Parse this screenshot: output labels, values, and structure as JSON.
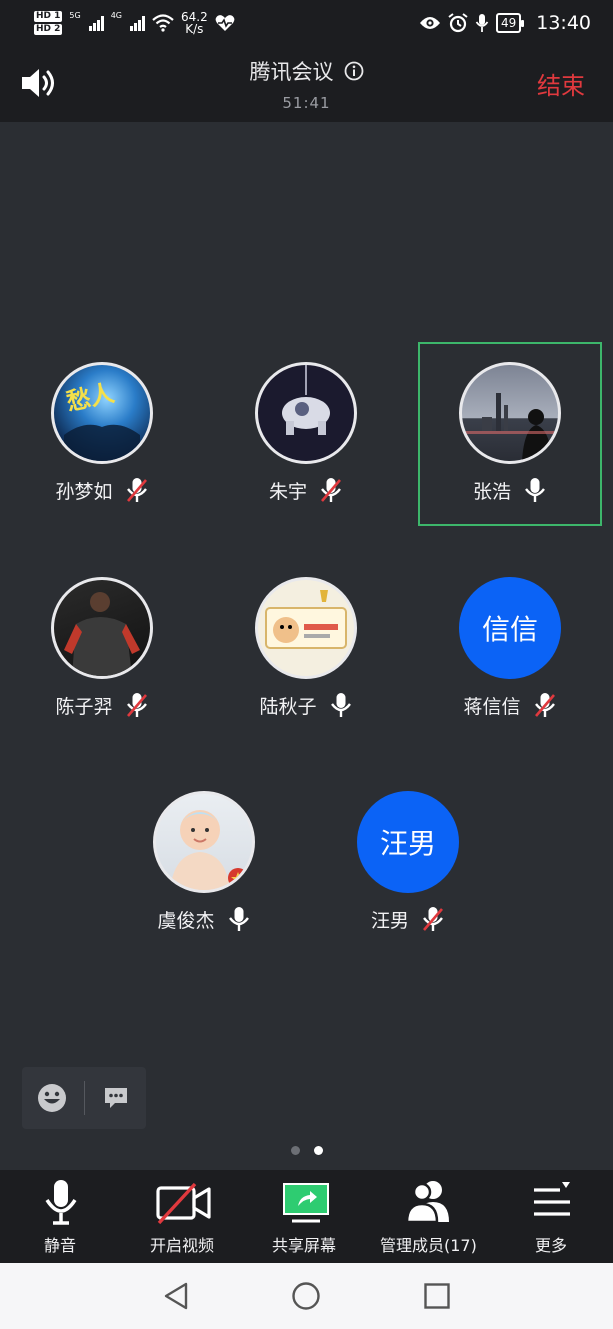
{
  "status_bar": {
    "hd1": "HD 1",
    "hd2": "HD 2",
    "net1": "5G",
    "net2": "4G",
    "speed_value": "64.2",
    "speed_unit": "K/s",
    "battery": "49",
    "time": "13:40"
  },
  "header": {
    "title": "腾讯会议",
    "timer": "51:41",
    "end_label": "结束"
  },
  "participants": [
    {
      "name": "孙梦如",
      "mic": "muted",
      "avatar": "photo-concert"
    },
    {
      "name": "朱宇",
      "mic": "muted",
      "avatar": "photo-astronaut"
    },
    {
      "name": "张浩",
      "mic": "on",
      "avatar": "photo-city",
      "active_speaker": true
    },
    {
      "name": "陈子羿",
      "mic": "muted",
      "avatar": "photo-jersey"
    },
    {
      "name": "陆秋子",
      "mic": "on",
      "avatar": "photo-cartoon"
    },
    {
      "name": "蒋信信",
      "mic": "muted",
      "avatar_text": "信信"
    },
    {
      "name": "虞俊杰",
      "mic": "on",
      "avatar": "photo-baby"
    },
    {
      "name": "汪男",
      "mic": "muted",
      "avatar_text": "汪男"
    }
  ],
  "pager": {
    "pages": 2,
    "current": 2
  },
  "toolbar": {
    "mute": "静音",
    "video": "开启视频",
    "share": "共享屏幕",
    "members": "管理成员(17)",
    "more": "更多"
  },
  "colors": {
    "background": "#2b2e33",
    "bar": "#1c1d20",
    "end_red": "#e0393e",
    "avatar_blue": "#0b63f6",
    "active_green": "#3db66b",
    "share_green": "#2ecc71"
  }
}
